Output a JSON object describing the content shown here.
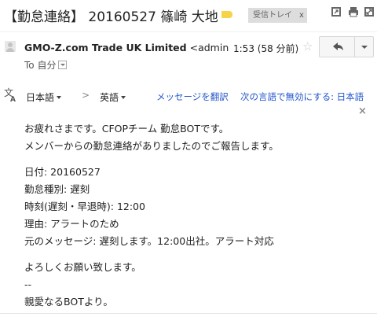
{
  "header": {
    "subject": "【勤怠連絡】 20160527 篠崎 大地",
    "label": "受信トレイ",
    "label_close": "x"
  },
  "message": {
    "sender_name": "GMO-Z.com Trade UK Limited",
    "sender_email": "<admin",
    "time": "1:53 (58 分前)",
    "to_prefix": "To",
    "to_recipient": "自分"
  },
  "translation": {
    "source_lang": "日本語",
    "arrow": ">",
    "target_lang": "英語",
    "translate_link": "メッセージを翻訳",
    "off_link": "次の言語で無効にする: 日本語",
    "close": "×"
  },
  "body": {
    "line1": "お疲れさまです。CFOPチーム 勤怠BOTです。",
    "line2": "メンバーからの勤怠連絡がありましたのでご報告します。",
    "line3": "日付: 20160527",
    "line4": "勤怠種別: 遅刻",
    "line5": "時刻(遅刻・早退時): 12:00",
    "line6": "理由: アラートのため",
    "line7": "元のメッセージ: 遅刻します。12:00出社。アラート対応",
    "line8": "よろしくお願い致します。",
    "line9": "--",
    "line10": "親愛なるBOTより。"
  },
  "icons": {
    "label_tag": "label-tag-icon",
    "new_window": "open-in-new-window-icon",
    "print": "print-icon",
    "expand": "expand-icon",
    "avatar": "avatar-icon",
    "star": "star-icon",
    "reply": "reply-icon",
    "more": "chevron-down-icon",
    "translate": "translate-icon"
  },
  "colors": {
    "link": "#2255cc",
    "label_tag": "#f5d44a",
    "label_bg": "#dddddd"
  }
}
